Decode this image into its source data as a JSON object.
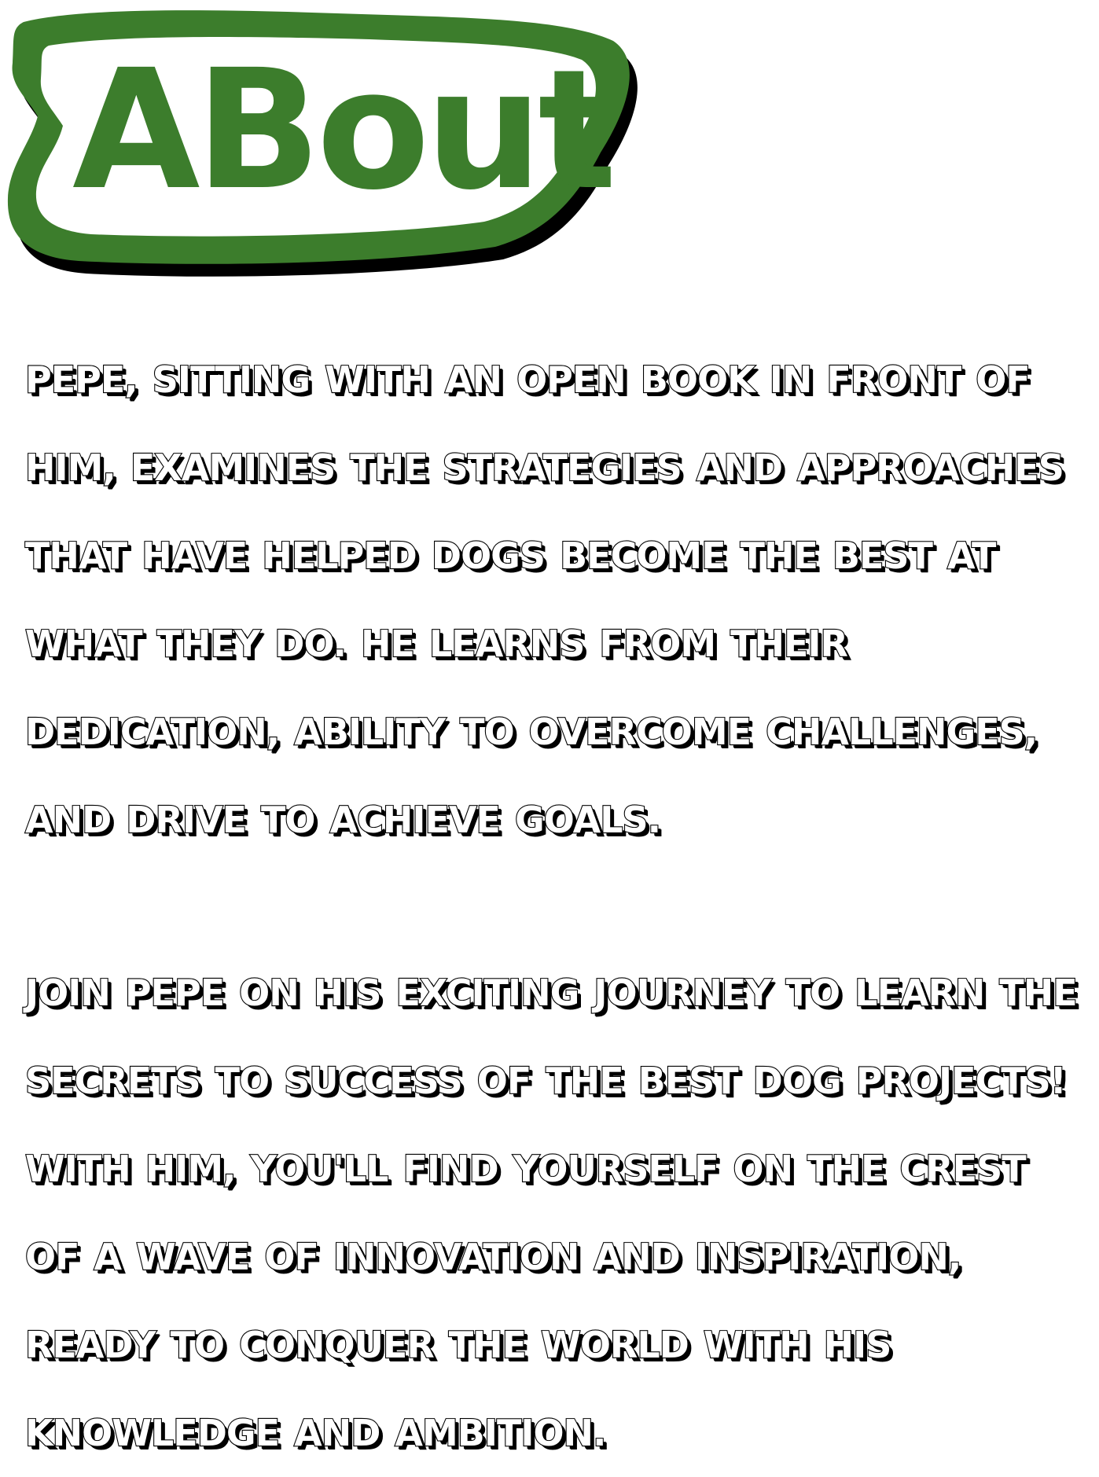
{
  "heading": {
    "title": "ABout"
  },
  "about": {
    "paragraph_1": "Pepe, sitting with an open book in front of him, examines the strategies and approaches that have helped dogs become the best at what they do. He learns from their dedication, ability to overcome challenges, and drive to achieve goals.",
    "paragraph_2": "Join Pepe on his exciting journey to learn the secrets to success of the best dog projects! With him, you'll find yourself on the crest of a wave of innovation and inspiration, ready to conquer the world with his knowledge and ambition."
  },
  "colors": {
    "badge_green": "#3c7d2c",
    "badge_shadow": "#000000",
    "text_fill": "#ffffff",
    "text_outline": "#000000",
    "background": "#ffffff"
  }
}
